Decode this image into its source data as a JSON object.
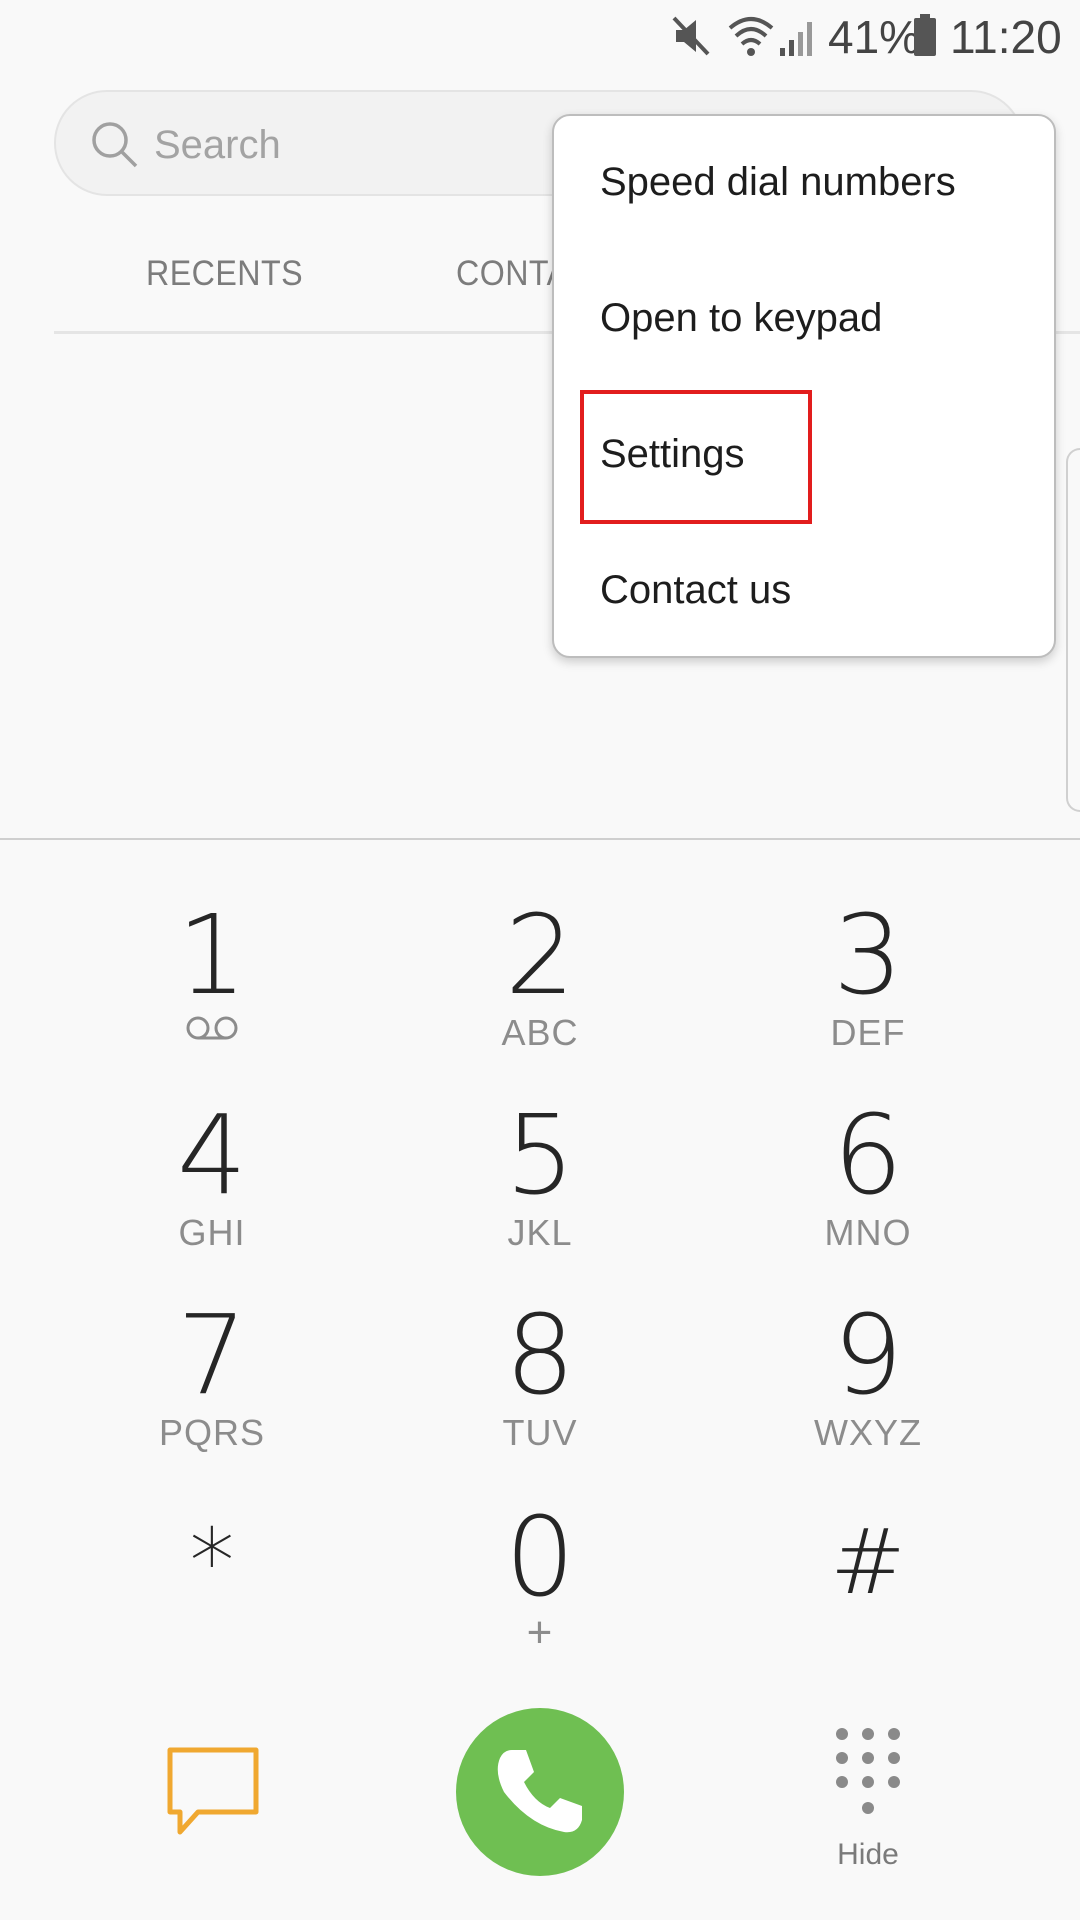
{
  "status_bar": {
    "battery": "41%",
    "time": "11:20",
    "icons": [
      "mute-icon",
      "wifi-icon",
      "signal-icon",
      "battery-icon"
    ]
  },
  "search": {
    "placeholder": "Search"
  },
  "tabs": [
    {
      "label": "RECENTS"
    },
    {
      "label": "CONTA"
    }
  ],
  "menu": {
    "items": [
      {
        "label": "Speed dial numbers"
      },
      {
        "label": "Open to keypad"
      },
      {
        "label": "Settings"
      },
      {
        "label": "Contact us"
      }
    ],
    "highlighted": "Settings"
  },
  "keypad": [
    {
      "digit": "1",
      "letters": ""
    },
    {
      "digit": "2",
      "letters": "ABC"
    },
    {
      "digit": "3",
      "letters": "DEF"
    },
    {
      "digit": "4",
      "letters": "GHI"
    },
    {
      "digit": "5",
      "letters": "JKL"
    },
    {
      "digit": "6",
      "letters": "MNO"
    },
    {
      "digit": "7",
      "letters": "PQRS"
    },
    {
      "digit": "8",
      "letters": "TUV"
    },
    {
      "digit": "9",
      "letters": "WXYZ"
    },
    {
      "digit": "*",
      "letters": ""
    },
    {
      "digit": "0",
      "letters": "+"
    },
    {
      "digit": "#",
      "letters": ""
    }
  ],
  "actions": {
    "hide_label": "Hide"
  },
  "colors": {
    "call": "#6fbf52",
    "message": "#f0a830",
    "highlight": "#e21d1d"
  }
}
